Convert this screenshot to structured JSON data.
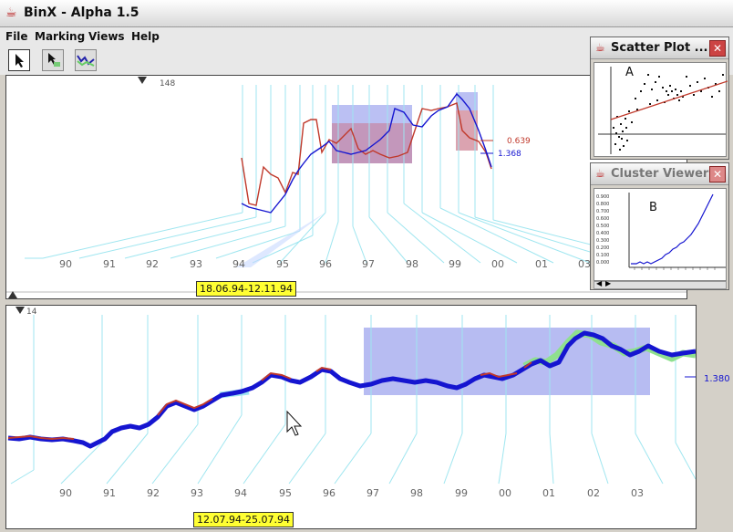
{
  "window": {
    "title": "BinX - Alpha 1.5"
  },
  "menu": {
    "file": "File",
    "marking": "Marking",
    "views": "Views",
    "help": "Help"
  },
  "top_panel": {
    "scale_label": "148",
    "year_labels": [
      "90",
      "91",
      "92",
      "93",
      "94",
      "95",
      "96",
      "97",
      "98",
      "99",
      "00",
      "01",
      "03"
    ],
    "series_labels": {
      "red": "0.639",
      "blue": "1.368"
    },
    "tooltip": "18.06.94-12.11.94"
  },
  "bottom_panel": {
    "scale_label": "14",
    "year_labels": [
      "90",
      "91",
      "92",
      "93",
      "94",
      "95",
      "96",
      "97",
      "98",
      "99",
      "00",
      "01",
      "02",
      "03"
    ],
    "value_label": "1.380",
    "tooltip": "12.07.94-25.07.94"
  },
  "scatter_window": {
    "title": "Scatter Plot ...",
    "marker": "A"
  },
  "cluster_window": {
    "title": "Cluster Viewer",
    "marker": "B",
    "y_ticks": [
      "0.900",
      "0.800",
      "0.700",
      "0.600",
      "0.500",
      "0.400",
      "0.300",
      "0.200",
      "0.100",
      "0.000"
    ]
  },
  "colors": {
    "red": "#c0392b",
    "blue": "#1515d0",
    "highlight": "#aab0f0",
    "cyan": "#9fe6f0",
    "green": "#8fe08f"
  }
}
